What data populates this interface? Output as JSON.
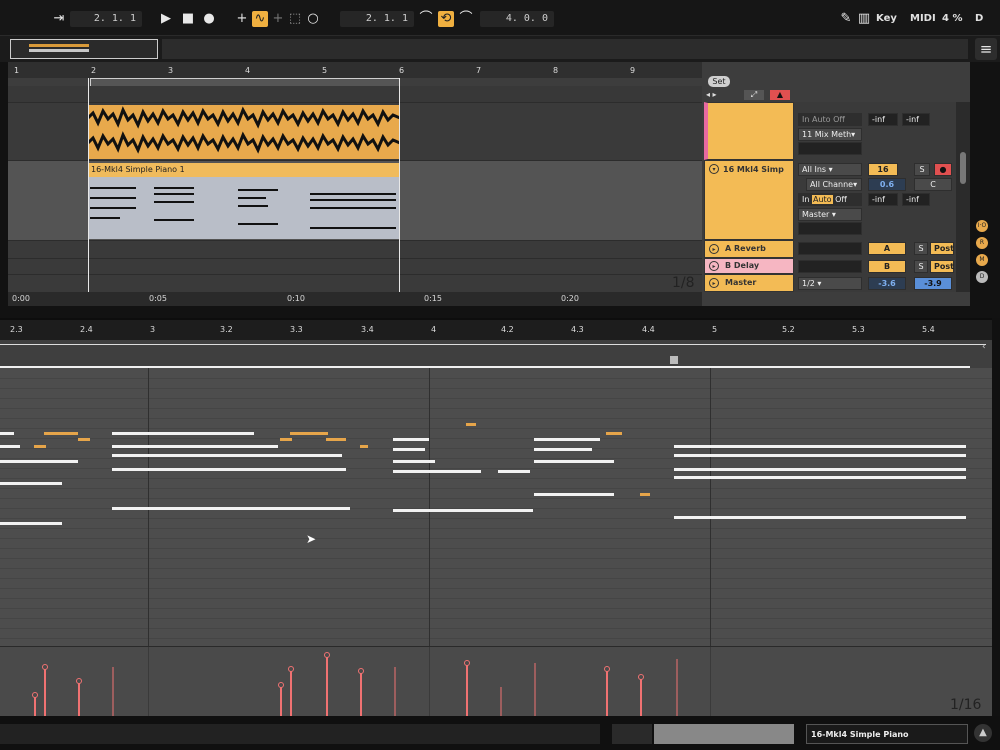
{
  "transport": {
    "position_left": "2.  1.  1",
    "position_loop_start": "2.  1.  1",
    "loop_length": "4.  0.  0",
    "key_label": "Key",
    "midi_label": "MIDI",
    "cpu": "4 %",
    "d_label": "D",
    "accent": "#f0b040"
  },
  "arrangement": {
    "ruler": [
      "1",
      "2",
      "3",
      "4",
      "5",
      "6",
      "7",
      "8",
      "9"
    ],
    "set_label": "Set",
    "clip_name": "16-Mkl4 Simple Piano 1",
    "tracks": [
      {
        "name": "16 Mkl4 Simp"
      },
      {
        "name": "A Reverb"
      },
      {
        "name": "B Delay"
      },
      {
        "name": "Master"
      }
    ],
    "io": {
      "in_label": "In",
      "auto_label": "Auto",
      "off_label": "Off",
      "mix_method": "11 Mix Meth",
      "all_ins": "All Ins",
      "all_channels": "All Channe",
      "master": "Master",
      "ratio": "1/2",
      "inf": "-inf",
      "track_num": "16",
      "s_label": "S",
      "vol": "0.6",
      "pan": "C",
      "send_a": "A",
      "send_b": "B",
      "post_label": "Post",
      "master_vol": "-3.6",
      "master_pan": "-3.9"
    },
    "quant": "1/8",
    "timecodes": [
      "0:00",
      "0:05",
      "0:10",
      "0:15",
      "0:20"
    ]
  },
  "piano_roll": {
    "ruler": [
      "2.3",
      "2.4",
      "3",
      "3.2",
      "3.3",
      "3.4",
      "4",
      "4.2",
      "4.3",
      "4.4",
      "5",
      "5.2",
      "5.3",
      "5.4"
    ],
    "quant": "1/16"
  },
  "status": {
    "track_label": "16-Mkl4 Simple Piano"
  }
}
